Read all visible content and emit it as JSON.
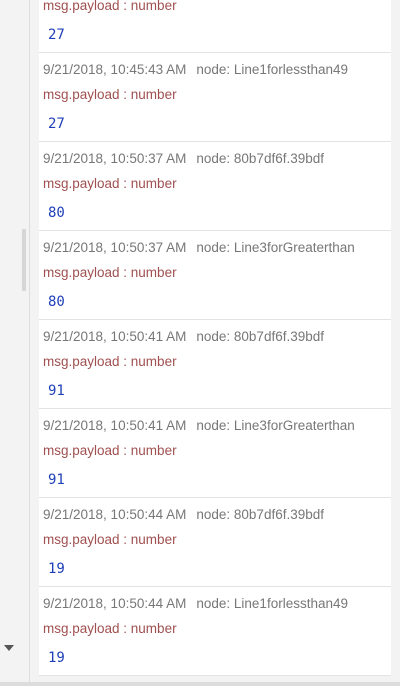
{
  "messages": [
    {
      "timestamp": "",
      "node": "",
      "topic": "msg.payload : number",
      "value": "27"
    },
    {
      "timestamp": "9/21/2018, 10:45:43 AM",
      "node": "node: Line1forlessthan49",
      "topic": "msg.payload : number",
      "value": "27"
    },
    {
      "timestamp": "9/21/2018, 10:50:37 AM",
      "node": "node: 80b7df6f.39bdf",
      "topic": "msg.payload : number",
      "value": "80"
    },
    {
      "timestamp": "9/21/2018, 10:50:37 AM",
      "node": "node: Line3forGreaterthan",
      "topic": "msg.payload : number",
      "value": "80"
    },
    {
      "timestamp": "9/21/2018, 10:50:41 AM",
      "node": "node: 80b7df6f.39bdf",
      "topic": "msg.payload : number",
      "value": "91"
    },
    {
      "timestamp": "9/21/2018, 10:50:41 AM",
      "node": "node: Line3forGreaterthan",
      "topic": "msg.payload : number",
      "value": "91"
    },
    {
      "timestamp": "9/21/2018, 10:50:44 AM",
      "node": "node: 80b7df6f.39bdf",
      "topic": "msg.payload : number",
      "value": "19"
    },
    {
      "timestamp": "9/21/2018, 10:50:44 AM",
      "node": "node: Line1forlessthan49",
      "topic": "msg.payload : number",
      "value": "19"
    }
  ],
  "colors": {
    "timestamp": "#777777",
    "topic": "#a05050",
    "value": "#1f3fb8"
  },
  "icons": {
    "panel_toggle": "caret-down-icon"
  }
}
